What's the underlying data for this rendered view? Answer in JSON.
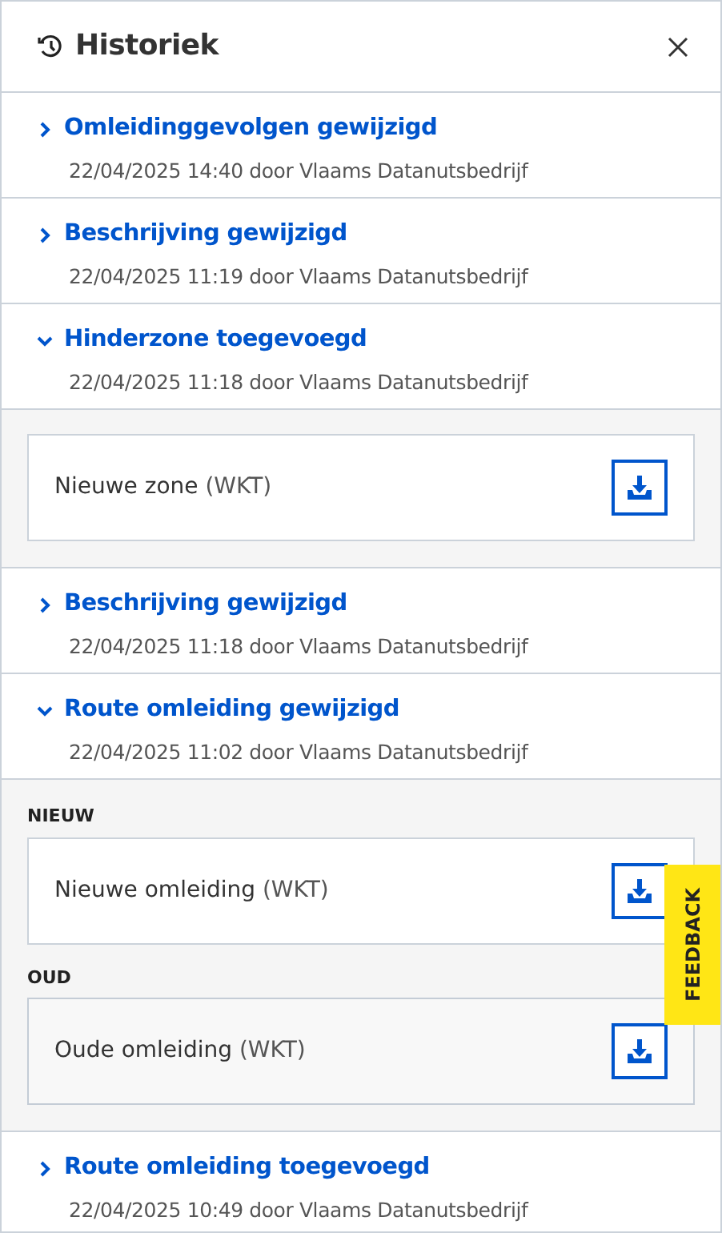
{
  "panel": {
    "title": "Historiek"
  },
  "entries": [
    {
      "title": "Omleidinggevolgen gewijzigd",
      "meta": "22/04/2025 14:40 door Vlaams Datanutsbedrijf",
      "expanded": false
    },
    {
      "title": "Beschrijving gewijzigd",
      "meta": "22/04/2025 11:19 door Vlaams Datanutsbedrijf",
      "expanded": false
    },
    {
      "title": "Hinderzone toegevoegd",
      "meta": "22/04/2025 11:18 door Vlaams Datanutsbedrijf",
      "expanded": true,
      "details": [
        {
          "label": "Nieuwe zone",
          "format": "(WKT)",
          "kind": "new"
        }
      ]
    },
    {
      "title": "Beschrijving gewijzigd",
      "meta": "22/04/2025 11:18 door Vlaams Datanutsbedrijf",
      "expanded": false
    },
    {
      "title": "Route omleiding gewijzigd",
      "meta": "22/04/2025 11:02 door Vlaams Datanutsbedrijf",
      "expanded": true,
      "details": [
        {
          "heading": "NIEUW",
          "label": "Nieuwe omleiding",
          "format": "(WKT)",
          "kind": "new"
        },
        {
          "heading": "OUD",
          "label": "Oude omleiding",
          "format": "(WKT)",
          "kind": "old"
        }
      ]
    },
    {
      "title": "Route omleiding toegevoegd",
      "meta": "22/04/2025 10:49 door Vlaams Datanutsbedrijf",
      "expanded": false
    }
  ],
  "feedback": {
    "label": "FEEDBACK"
  }
}
